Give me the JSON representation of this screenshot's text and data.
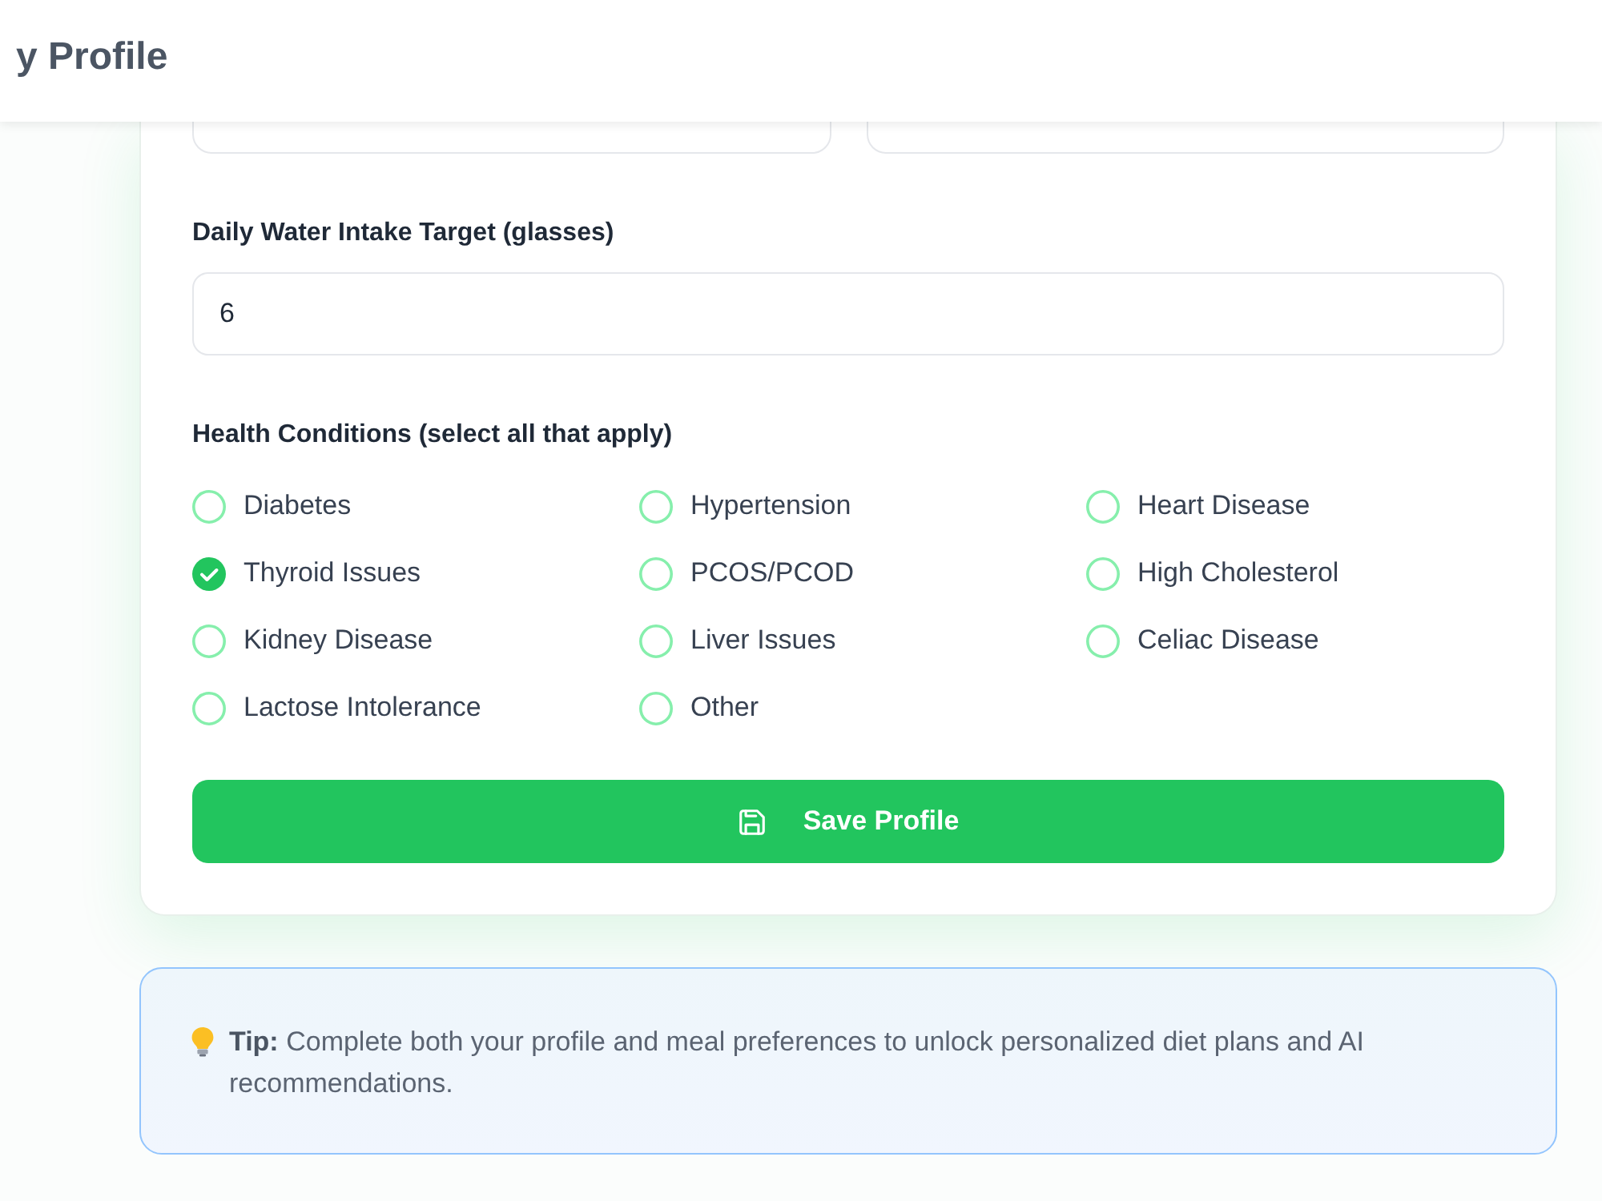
{
  "header": {
    "title": "y Profile"
  },
  "water_intake": {
    "label": "Daily Water Intake Target (glasses)",
    "value": "6"
  },
  "health_conditions": {
    "label": "Health Conditions (select all that apply)",
    "options": [
      {
        "label": "Diabetes",
        "checked": false
      },
      {
        "label": "Hypertension",
        "checked": false
      },
      {
        "label": "Heart Disease",
        "checked": false
      },
      {
        "label": "Thyroid Issues",
        "checked": true
      },
      {
        "label": "PCOS/PCOD",
        "checked": false
      },
      {
        "label": "High Cholesterol",
        "checked": false
      },
      {
        "label": "Kidney Disease",
        "checked": false
      },
      {
        "label": "Liver Issues",
        "checked": false
      },
      {
        "label": "Celiac Disease",
        "checked": false
      },
      {
        "label": "Lactose Intolerance",
        "checked": false
      },
      {
        "label": "Other",
        "checked": false
      }
    ]
  },
  "save_button": {
    "label": "Save Profile"
  },
  "tip": {
    "text": "**Tip:** Complete both your profile and meal preferences to unlock personalized diet plans and AI recommendations."
  }
}
